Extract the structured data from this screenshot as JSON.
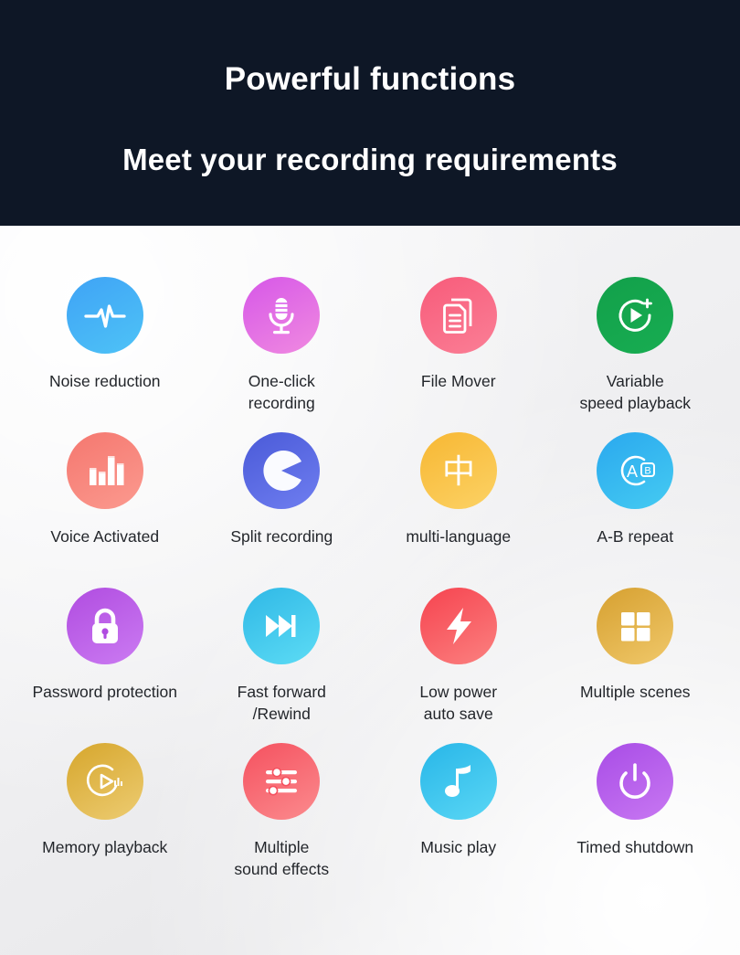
{
  "hero": {
    "title": "Powerful functions",
    "subtitle": "Meet your recording requirements",
    "divider": "horizontal-rule",
    "bg_color": "#0e1726",
    "text_color": "#ffffff"
  },
  "features": {
    "background_colors": [
      "#f7f7f8",
      "#e9e9eb"
    ],
    "label_color": "#23262b",
    "items": [
      {
        "label": "Noise reduction",
        "icon": "waveform-icon",
        "color_from": "#3fa3f5",
        "color_to": "#4ec3f7"
      },
      {
        "label": "One-click\nrecording",
        "icon": "microphone-icon",
        "color_from": "#d657e8",
        "color_to": "#f08ae0"
      },
      {
        "label": "File Mover",
        "icon": "documents-icon",
        "color_from": "#f85b7a",
        "color_to": "#fa7f96"
      },
      {
        "label": "Variable\nspeed playback",
        "icon": "play-plus-icon",
        "color_from": "#12a04a",
        "color_to": "#18ad52"
      },
      {
        "label": "Voice Activated",
        "icon": "bar-levels-icon",
        "color_from": "#f5776f",
        "color_to": "#fb9a8f"
      },
      {
        "label": "Split recording",
        "icon": "split-pie-icon",
        "color_from": "#4a5ad8",
        "color_to": "#6f7ef0"
      },
      {
        "label": "multi-language",
        "icon": "chinese-character-icon",
        "color_from": "#f7b733",
        "color_to": "#fcd265"
      },
      {
        "label": "A-B repeat",
        "icon": "ab-repeat-icon",
        "color_from": "#2aa8ee",
        "color_to": "#45cbf2"
      },
      {
        "label": "Password protection",
        "icon": "lock-icon",
        "color_from": "#b04ce0",
        "color_to": "#cb7bf2"
      },
      {
        "label": "Fast forward\n/Rewind",
        "icon": "fast-forward-icon",
        "color_from": "#2fb8e6",
        "color_to": "#5ddcf5"
      },
      {
        "label": "Low power\nauto save",
        "icon": "lightning-bolt-icon",
        "color_from": "#f6434f",
        "color_to": "#fb8180"
      },
      {
        "label": "Multiple scenes",
        "icon": "grid-four-icon",
        "color_from": "#d6a030",
        "color_to": "#f0c86a"
      },
      {
        "label": "Memory playback",
        "icon": "memory-play-icon",
        "color_from": "#d6a62c",
        "color_to": "#edcc72"
      },
      {
        "label": "Multiple\nsound effects",
        "icon": "sliders-icon",
        "color_from": "#f5515f",
        "color_to": "#fb8b8e"
      },
      {
        "label": "Music play",
        "icon": "music-note-icon",
        "color_from": "#28b6e8",
        "color_to": "#5ad7f5"
      },
      {
        "label": "Timed shutdown",
        "icon": "power-icon",
        "color_from": "#a84ce6",
        "color_to": "#c878f2"
      }
    ]
  }
}
